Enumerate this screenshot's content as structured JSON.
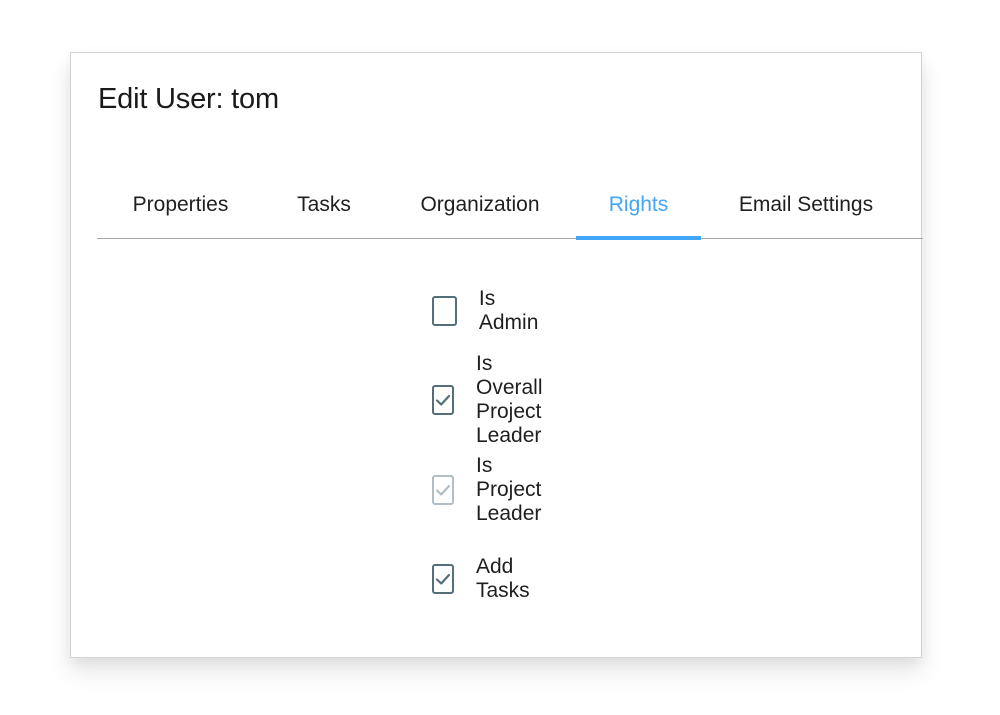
{
  "dialog": {
    "title": "Edit User: tom"
  },
  "tabs": [
    {
      "label": "Properties",
      "active": false
    },
    {
      "label": "Tasks",
      "active": false
    },
    {
      "label": "Organization",
      "active": false
    },
    {
      "label": "Rights",
      "active": true
    },
    {
      "label": "Email Settings",
      "active": false
    }
  ],
  "accent_color": "#42a5f5",
  "rights": [
    {
      "label": "Is Admin",
      "checked": false,
      "disabled": false
    },
    {
      "label": "Is Overall Project Leader",
      "checked": true,
      "disabled": false
    },
    {
      "label": "Is Project Leader",
      "checked": true,
      "disabled": true
    },
    {
      "label": "Add Tasks",
      "checked": true,
      "disabled": false
    }
  ]
}
